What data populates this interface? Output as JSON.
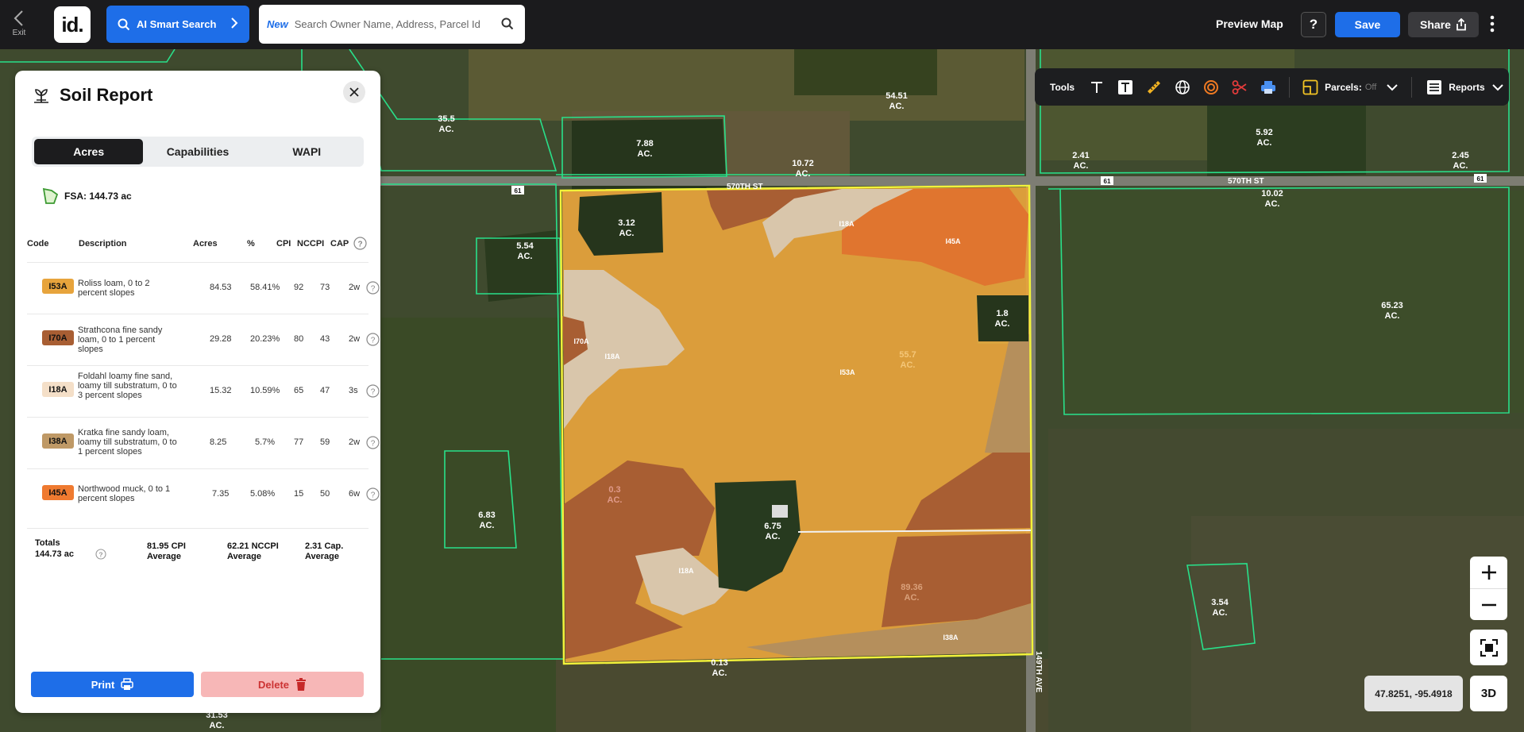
{
  "topbar": {
    "exit_label": "Exit",
    "logo_text": "id.",
    "ai_search_label": "AI Smart Search",
    "search_new_tag": "New",
    "search_placeholder": "Search Owner Name, Address, Parcel Id",
    "preview_label": "Preview Map",
    "help_label": "?",
    "save_label": "Save",
    "share_label": "Share"
  },
  "colors": {
    "accent": "#1e6ee8",
    "topbar_bg": "#1b1b1d",
    "parcel_outline": "#29e08a",
    "field_outline": "#f2f23a",
    "soil_I53A": "#e7a43c",
    "soil_I70A": "#a85e33",
    "soil_I18A": "#d9c6ab",
    "soil_I38A": "#b58f5c",
    "soil_I45A": "#e0752f"
  },
  "tools": {
    "label": "Tools",
    "icons": [
      "text-icon",
      "text-box-icon",
      "ruler-icon",
      "globe-icon",
      "radius-icon",
      "scissors-icon",
      "printer-icon",
      "parcels-layer-icon"
    ],
    "parcels_label": "Parcels:",
    "parcels_state": "Off",
    "reports_label": "Reports"
  },
  "map": {
    "acre_labels": [
      {
        "num": "35.5",
        "unit": "AC."
      },
      {
        "num": "7.88",
        "unit": "AC."
      },
      {
        "num": "54.51",
        "unit": "AC."
      },
      {
        "num": "10.72",
        "unit": "AC."
      },
      {
        "num": "5.92",
        "unit": "AC."
      },
      {
        "num": "2.41",
        "unit": "AC."
      },
      {
        "num": "2.45",
        "unit": "AC."
      },
      {
        "num": "10.02",
        "unit": "AC."
      },
      {
        "num": "3.12",
        "unit": "AC."
      },
      {
        "num": "5.54",
        "unit": "AC."
      },
      {
        "num": "1.8",
        "unit": "AC."
      },
      {
        "num": "65.23",
        "unit": "AC."
      },
      {
        "num": "55.7",
        "unit": "AC."
      },
      {
        "num": "6.83",
        "unit": "AC."
      },
      {
        "num": "6.75",
        "unit": "AC."
      },
      {
        "num": "0.3",
        "unit": "AC."
      },
      {
        "num": "89.36",
        "unit": "AC."
      },
      {
        "num": "3.54",
        "unit": "AC."
      },
      {
        "num": "31.53",
        "unit": "AC."
      },
      {
        "num": "0.13",
        "unit": "AC."
      }
    ],
    "soil_labels": [
      "I18A",
      "I45A",
      "I70A",
      "I18A",
      "I53A",
      "I18A",
      "I38A"
    ],
    "roads": [
      "570TH ST",
      "570TH ST",
      "61",
      "61",
      "61",
      "149TH AVE"
    ],
    "coordinates": "47.8251, -95.4918",
    "btn_3d": "3D"
  },
  "soil_report": {
    "title": "Soil Report",
    "tabs": [
      {
        "label": "Acres",
        "active": true
      },
      {
        "label": "Capabilities",
        "active": false
      },
      {
        "label": "WAPI",
        "active": false
      }
    ],
    "fsa": "FSA: 144.73 ac",
    "columns": {
      "code": "Code",
      "description": "Description",
      "acres": "Acres",
      "pct": "%",
      "cpi": "CPI",
      "nccpi": "NCCPI",
      "cap": "CAP"
    },
    "rows": [
      {
        "code": "I53A",
        "color": "#e7a43c",
        "description": "Roliss loam, 0 to 2 percent slopes",
        "acres": "84.53",
        "pct": "58.41%",
        "cpi": "92",
        "nccpi": "73",
        "cap": "2w"
      },
      {
        "code": "I70A",
        "color": "#a85e33",
        "description": "Strathcona fine sandy loam, 0 to 1 percent slopes",
        "acres": "29.28",
        "pct": "20.23%",
        "cpi": "80",
        "nccpi": "43",
        "cap": "2w"
      },
      {
        "code": "I18A",
        "color": "#f4dfc8",
        "description": "Foldahl loamy fine sand, loamy till substratum, 0 to 3 percent slopes",
        "acres": "15.32",
        "pct": "10.59%",
        "cpi": "65",
        "nccpi": "47",
        "cap": "3s"
      },
      {
        "code": "I38A",
        "color": "#bf9966",
        "description": "Kratka fine sandy loam, loamy till substratum, 0 to 1 percent slopes",
        "acres": "8.25",
        "pct": "5.7%",
        "cpi": "77",
        "nccpi": "59",
        "cap": "2w"
      },
      {
        "code": "I45A",
        "color": "#ef7a30",
        "description": "Northwood muck, 0 to 1 percent slopes",
        "acres": "7.35",
        "pct": "5.08%",
        "cpi": "15",
        "nccpi": "50",
        "cap": "6w"
      }
    ],
    "totals": {
      "label": "Totals",
      "acres": "144.73 ac",
      "cpi": "81.95 CPI",
      "cpi_sub": "Average",
      "nccpi": "62.21 NCCPI",
      "nccpi_sub": "Average",
      "cap": "2.31 Cap.",
      "cap_sub": "Average"
    },
    "print_label": "Print",
    "delete_label": "Delete"
  }
}
